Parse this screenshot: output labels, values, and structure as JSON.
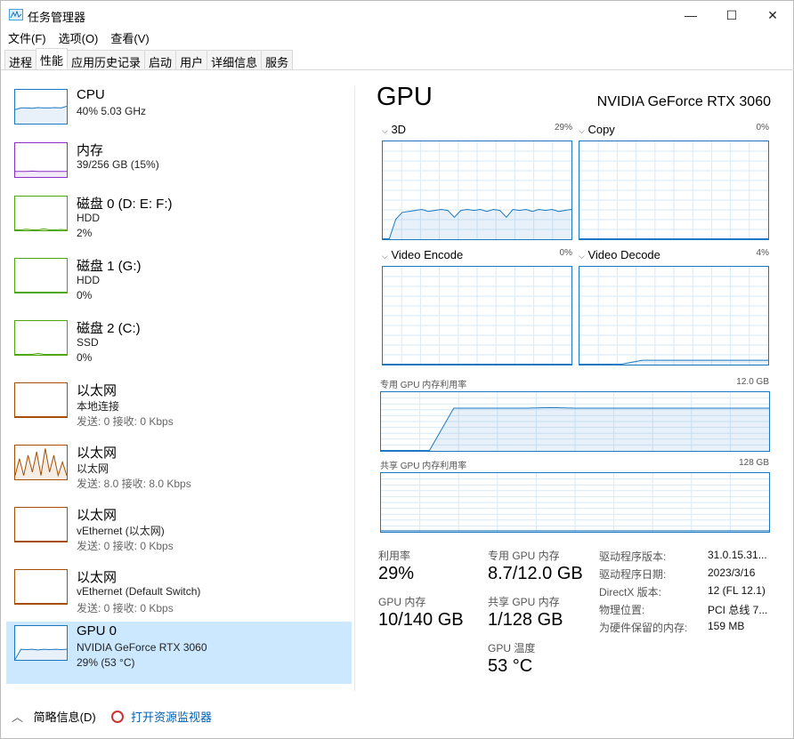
{
  "window": {
    "title": "任务管理器",
    "min": "—",
    "max": "☐",
    "close": "✕"
  },
  "menu": [
    "文件(F)",
    "选项(O)",
    "查看(V)"
  ],
  "tabs": [
    "进程",
    "性能",
    "应用历史记录",
    "启动",
    "用户",
    "详细信息",
    "服务"
  ],
  "sidebar": [
    {
      "name": "CPU",
      "lines": [
        "40% 5.03 GHz"
      ],
      "color": "#1a78c2",
      "spark": [
        0.4,
        0.45,
        0.45,
        0.44,
        0.46,
        0.45,
        0.45,
        0.46,
        0.45,
        0.5
      ]
    },
    {
      "name": "内存",
      "lines": [
        "39/256 GB (15%)"
      ],
      "color": "#8b2fc9",
      "spark": [
        0.15,
        0.15,
        0.15,
        0.16,
        0.15,
        0.15,
        0.15,
        0.15,
        0.15,
        0.15
      ]
    },
    {
      "name": "磁盘 0 (D: E: F:)",
      "lines": [
        "HDD",
        "2%"
      ],
      "color": "#4ca60c",
      "spark": [
        0,
        0,
        0.02,
        0,
        0,
        0.03,
        0,
        0,
        0.01,
        0
      ]
    },
    {
      "name": "磁盘 1 (G:)",
      "lines": [
        "HDD",
        "0%"
      ],
      "color": "#4ca60c",
      "spark": [
        0,
        0,
        0,
        0,
        0,
        0,
        0,
        0,
        0,
        0
      ]
    },
    {
      "name": "磁盘 2 (C:)",
      "lines": [
        "SSD",
        "0%"
      ],
      "color": "#4ca60c",
      "spark": [
        0,
        0,
        0,
        0,
        0.03,
        0,
        0,
        0,
        0,
        0
      ]
    },
    {
      "name": "以太网",
      "lines": [
        "本地连接",
        "发送: 0 接收: 0 Kbps"
      ],
      "color": "#a74f01",
      "spark": [
        0,
        0,
        0,
        0,
        0,
        0,
        0,
        0,
        0,
        0
      ]
    },
    {
      "name": "以太网",
      "lines": [
        "以太网",
        "发送: 8.0 接收: 8.0 Kbps"
      ],
      "color": "#a74f01",
      "spark": [
        0.1,
        0.6,
        0.1,
        0.7,
        0.2,
        0.8,
        0.1,
        0.9,
        0.2,
        0.7,
        0.1,
        0.5,
        0.1
      ]
    },
    {
      "name": "以太网",
      "lines": [
        "vEthernet (以太网)",
        "发送: 0 接收: 0 Kbps"
      ],
      "color": "#a74f01",
      "spark": [
        0,
        0,
        0,
        0,
        0,
        0,
        0,
        0,
        0,
        0
      ]
    },
    {
      "name": "以太网",
      "lines": [
        "vEthernet (Default Switch)",
        "发送: 0 接收: 0 Kbps"
      ],
      "color": "#a74f01",
      "spark": [
        0,
        0,
        0,
        0,
        0,
        0,
        0,
        0,
        0,
        0
      ]
    },
    {
      "name": "GPU 0",
      "lines": [
        "NVIDIA GeForce RTX 3060",
        "29% (53 °C)"
      ],
      "color": "#1a78c2",
      "spark": [
        0,
        0.3,
        0.29,
        0.3,
        0.28,
        0.3,
        0.29,
        0.3,
        0.29,
        0.3
      ]
    }
  ],
  "main": {
    "title": "GPU",
    "device": "NVIDIA GeForce RTX 3060",
    "engines": [
      {
        "label": "3D",
        "pct": "29%",
        "values": [
          0,
          0,
          0.2,
          0.27,
          0.28,
          0.29,
          0.3,
          0.28,
          0.29,
          0.3,
          0.29,
          0.22,
          0.29,
          0.3,
          0.29,
          0.3,
          0.28,
          0.3,
          0.29,
          0.22,
          0.3,
          0.29,
          0.3,
          0.28,
          0.3,
          0.29,
          0.3,
          0.28,
          0.29,
          0.3
        ]
      },
      {
        "label": "Copy",
        "pct": "0%",
        "values": [
          0,
          0,
          0,
          0,
          0,
          0,
          0,
          0,
          0,
          0
        ]
      },
      {
        "label": "Video Encode",
        "pct": "0%",
        "values": [
          0,
          0,
          0,
          0,
          0,
          0,
          0,
          0,
          0,
          0
        ]
      },
      {
        "label": "Video Decode",
        "pct": "4%",
        "values": [
          0,
          0,
          0,
          0.04,
          0.04,
          0.04,
          0.04,
          0.04,
          0.04,
          0.04
        ]
      }
    ],
    "dedicated": {
      "label": "专用 GPU 内存利用率",
      "max": "12.0 GB",
      "values": [
        0,
        0,
        0,
        0.72,
        0.72,
        0.72,
        0.72,
        0.73,
        0.72,
        0.72,
        0.72,
        0.72,
        0.72,
        0.72,
        0.72,
        0.72,
        0.72
      ]
    },
    "shared": {
      "label": "共享 GPU 内存利用率",
      "max": "128 GB",
      "values": [
        0.01,
        0.01,
        0.01,
        0.01,
        0.01
      ]
    },
    "stats": [
      {
        "label": "利用率",
        "value": "29%"
      },
      {
        "label": "专用 GPU 内存",
        "value": "8.7/12.0 GB"
      },
      {
        "label": "GPU 内存",
        "value": "10/140 GB"
      },
      {
        "label": "共享 GPU 内存",
        "value": "1/128 GB"
      },
      {
        "label": "GPU 温度",
        "value": "53 °C"
      }
    ],
    "details": [
      {
        "label": "驱动程序版本:",
        "value": "31.0.15.31..."
      },
      {
        "label": "驱动程序日期:",
        "value": "2023/3/16"
      },
      {
        "label": "DirectX 版本:",
        "value": "12 (FL 12.1)"
      },
      {
        "label": "物理位置:",
        "value": "PCI 总线 7..."
      },
      {
        "label": "为硬件保留的内存:",
        "value": "159 MB"
      }
    ]
  },
  "footer": {
    "summary": "简略信息(D)",
    "monitor": "打开资源监视器"
  }
}
